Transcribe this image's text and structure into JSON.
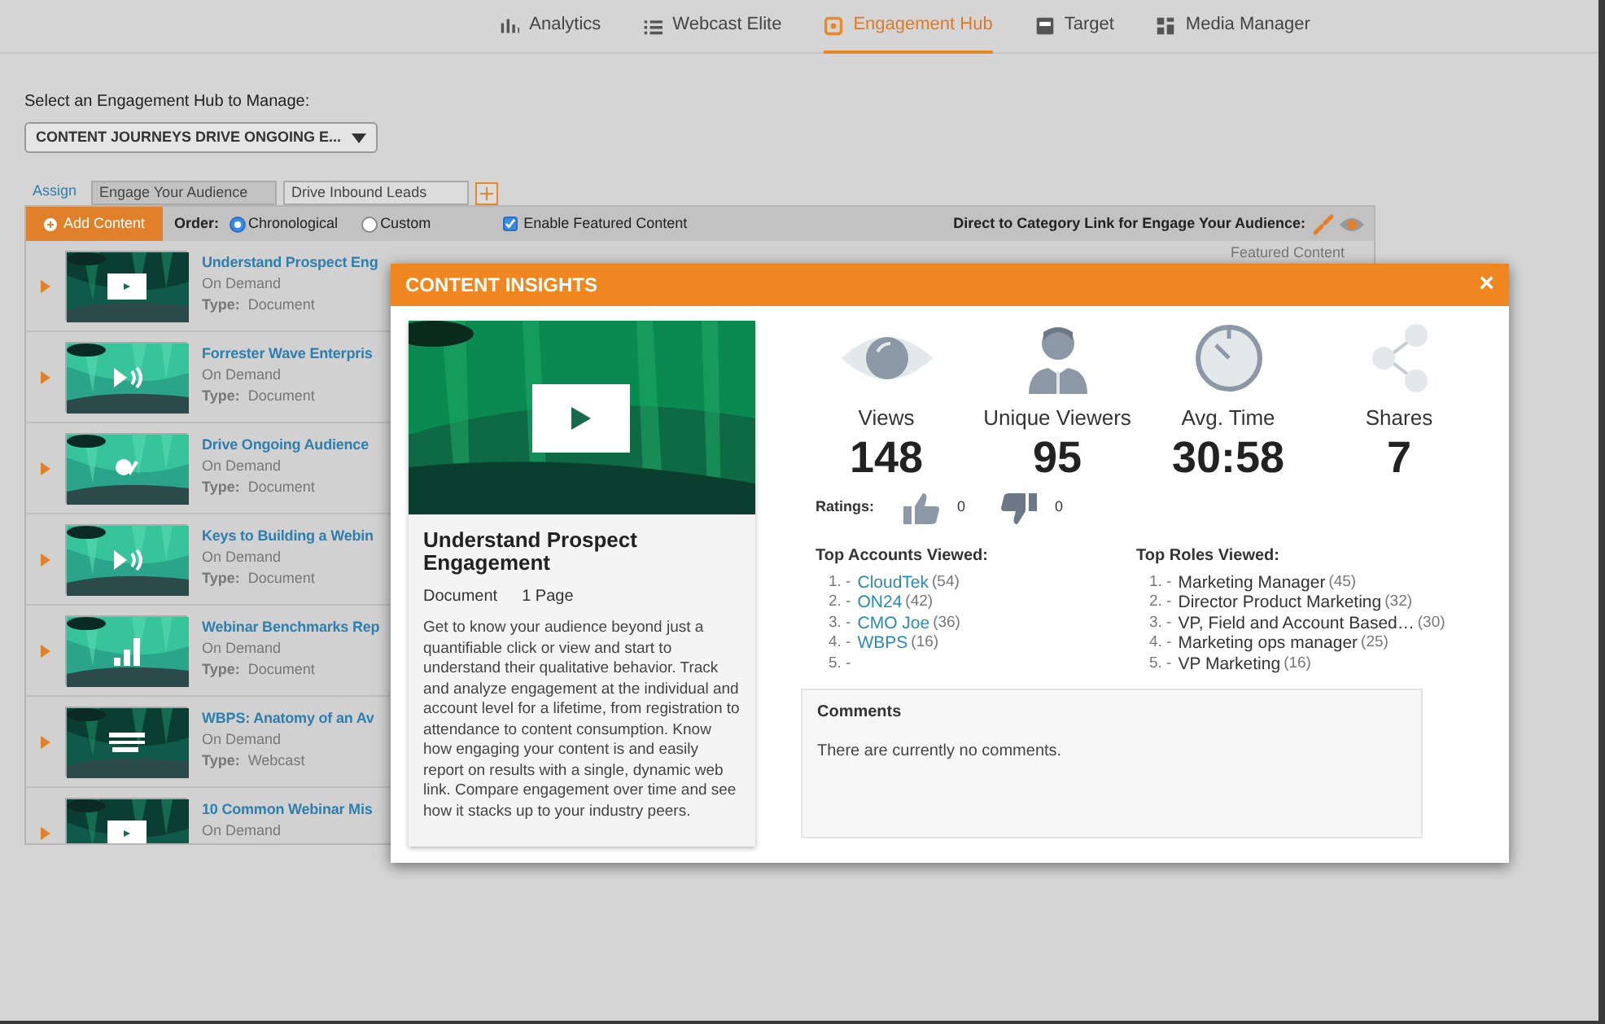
{
  "nav": [
    {
      "label": "Analytics",
      "selected": false
    },
    {
      "label": "Webcast Elite",
      "selected": false
    },
    {
      "label": "Engagement Hub",
      "selected": true
    },
    {
      "label": "Target",
      "selected": false
    },
    {
      "label": "Media Manager",
      "selected": false
    }
  ],
  "hub_select": {
    "label": "Select an Engagement Hub to Manage:",
    "value": "CONTENT JOURNEYS DRIVE ONGOING E..."
  },
  "category_tabs": {
    "assign": "Assign",
    "tabs": [
      {
        "label": "Engage Your Audience",
        "selected": true
      },
      {
        "label": "Drive Inbound Leads",
        "selected": false
      }
    ]
  },
  "toolbar": {
    "add_button": "Add Content",
    "order_label": "Order:",
    "order_options": [
      {
        "label": "Chronological",
        "selected": true
      },
      {
        "label": "Custom",
        "selected": false
      }
    ],
    "featured": {
      "label": "Enable Featured Content",
      "checked": true
    },
    "direct_link": "Direct to Category Link for Engage Your Audience:"
  },
  "featured_header": "Featured Content",
  "content_items": [
    {
      "title": "Understand Prospect Eng",
      "status": "On Demand",
      "type_label": "Type:",
      "type": "Document",
      "kind": "video"
    },
    {
      "title": "Forrester Wave Enterpris",
      "status": "On Demand",
      "type_label": "Type:",
      "type": "Document",
      "kind": "audio"
    },
    {
      "title": "Drive Ongoing Audience",
      "status": "On Demand",
      "type_label": "Type:",
      "type": "Document",
      "kind": "chat"
    },
    {
      "title": "Keys to Building a Webin",
      "status": "On Demand",
      "type_label": "Type:",
      "type": "Document",
      "kind": "audio"
    },
    {
      "title": "Webinar Benchmarks Rep",
      "status": "On Demand",
      "type_label": "Type:",
      "type": "Document",
      "kind": "chart"
    },
    {
      "title": "WBPS: Anatomy of an Av",
      "status": "On Demand",
      "type_label": "Type:",
      "type": "Webcast",
      "kind": "text"
    },
    {
      "title": "10 Common Webinar Mis",
      "status": "On Demand",
      "kind": "video"
    }
  ],
  "modal": {
    "title": "CONTENT INSIGHTS",
    "close": "×",
    "card": {
      "title": "Understand Prospect Engagement",
      "type": "Document",
      "pages": "1 Page",
      "description": "Get to know your audience beyond just a quantifiable click or view and start to understand their qualitative behavior. Track and analyze engagement at the individual and account level for a lifetime, from registration to attendance to content consumption. Know how engaging your content is and easily report on results with a single, dynamic web link. Compare engagement over time and see how it stacks up to your industry peers."
    },
    "stats": [
      {
        "label": "Views",
        "value": "148",
        "kind": "eye"
      },
      {
        "label": "Unique Viewers",
        "value": "95",
        "kind": "person"
      },
      {
        "label": "Avg. Time",
        "value": "30:58",
        "kind": "clock"
      },
      {
        "label": "Shares",
        "value": "7",
        "kind": "share"
      }
    ],
    "ratings": {
      "label": "Ratings:",
      "up": "0",
      "down": "0"
    },
    "top_accounts": {
      "title": "Top Accounts Viewed:",
      "items": [
        {
          "rank": "1. -",
          "name": "CloudTek",
          "count": "(54)"
        },
        {
          "rank": "2. -",
          "name": "ON24",
          "count": "(42)"
        },
        {
          "rank": "3. -",
          "name": "CMO Joe",
          "count": "(36)"
        },
        {
          "rank": "4. -",
          "name": "WBPS",
          "count": "(16)"
        },
        {
          "rank": "5. -"
        }
      ]
    },
    "top_roles": {
      "title": "Top Roles Viewed:",
      "items": [
        {
          "rank": "1. -",
          "name": "Marketing Manager",
          "count": "(45)"
        },
        {
          "rank": "2. -",
          "name": "Director Product Marketing",
          "count": "(32)"
        },
        {
          "rank": "3. -",
          "name": "VP, Field and Account Based…",
          "count": "(30)"
        },
        {
          "rank": "4. -",
          "name": "Marketing ops manager",
          "count": "(25)"
        },
        {
          "rank": "5. -",
          "name": "VP Marketing",
          "count": "(16)"
        }
      ]
    },
    "comments": {
      "title": "Comments",
      "text": "There are currently no comments."
    }
  }
}
